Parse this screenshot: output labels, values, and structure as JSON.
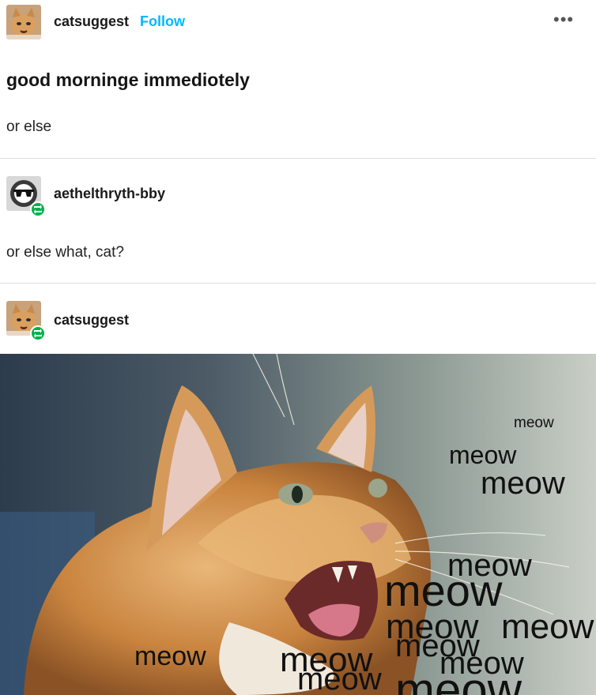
{
  "posts": [
    {
      "username": "catsuggest",
      "follow_label": "Follow",
      "more_label": "•••",
      "title": "good morninge immediotely",
      "body": "or else"
    },
    {
      "username": "aethelthryth-bby",
      "body": "or else what, cat?"
    },
    {
      "username": "catsuggest"
    }
  ],
  "image_text": {
    "meow_1": "meow",
    "meow_2": "meow",
    "meow_3": "meow",
    "meow_4": "meow",
    "meow_5": "meow",
    "meow_6": "meow",
    "meow_7": "meow",
    "meow_8": "meow",
    "meow_9": "meow",
    "meow_10": "meow",
    "meow_11": "meow",
    "meow_12": "meow",
    "meow_13": "meow"
  }
}
